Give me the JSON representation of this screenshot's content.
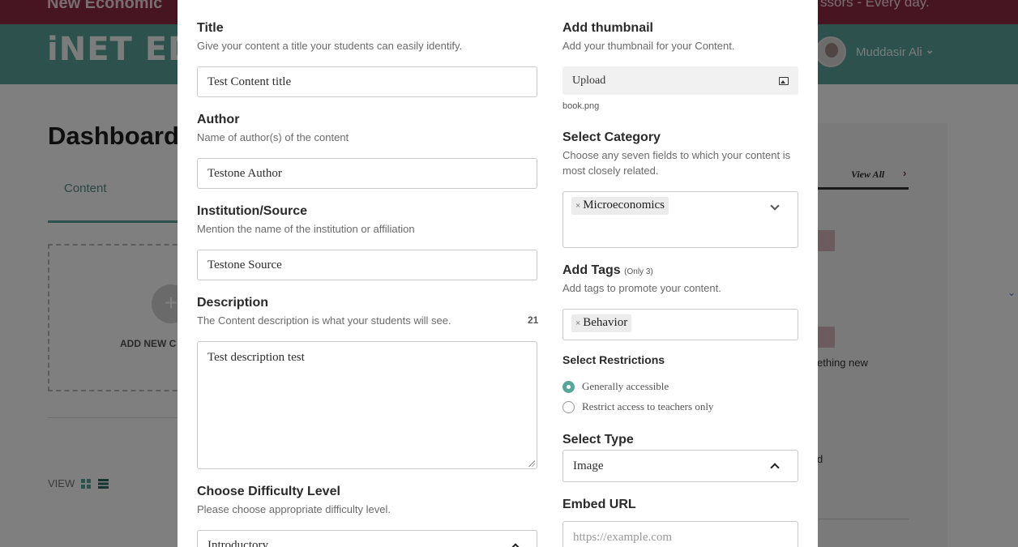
{
  "background": {
    "topbar": {
      "left_text": "New Economic",
      "right_text": "ssors - Every day."
    },
    "navbar": {
      "logo": "iNET ED.",
      "user_name": "Muddasir Ali",
      "user_chevron": "⌄"
    },
    "dashboard": {
      "title": "Dashboard",
      "tab_content": "Content",
      "add_plus": "+",
      "add_new_label": "ADD NEW C",
      "view_label": "VIEW"
    },
    "right_panel": {
      "view_all": "View All",
      "view_all_chevron": "›",
      "something_text": "ething new",
      "d_text": "d"
    },
    "far_chevron": "⌄"
  },
  "modal": {
    "title_section": {
      "label": "Title",
      "hint": "Give your content a title your students can easily identify.",
      "value": "Test Content title"
    },
    "author_section": {
      "label": "Author",
      "hint": "Name of author(s) of the content",
      "value": "Testone Author"
    },
    "institution_section": {
      "label": "Institution/Source",
      "hint": "Mention the name of the institution or affiliation",
      "value": "Testone Source"
    },
    "description_section": {
      "label": "Description",
      "hint": "The Content description is what your students will see.",
      "counter": "21",
      "value": "Test description test"
    },
    "difficulty_section": {
      "label": "Choose Difficulty Level",
      "hint": "Please choose appropriate difficulty level.",
      "value": "Introductory"
    },
    "thumbnail_section": {
      "label": "Add thumbnail",
      "hint": "Add your thumbnail for your Content.",
      "upload_label": "Upload",
      "filename": "book.png"
    },
    "category_section": {
      "label": "Select Category",
      "hint": "Choose any seven fields to which your content is most closely related.",
      "remove_glyph": "×",
      "selected": "Microeconomics"
    },
    "tags_section": {
      "label": "Add Tags",
      "label_note": "(Only 3)",
      "hint": "Add tags to promote your content.",
      "remove_glyph": "×",
      "selected": "Behavior"
    },
    "restrictions_section": {
      "label": "Select Restrictions",
      "options": [
        "Generally accessible",
        "Restrict access to teachers only"
      ],
      "selected_index": 0
    },
    "type_section": {
      "label": "Select Type",
      "value": "Image"
    },
    "embed_section": {
      "label": "Embed URL",
      "placeholder": "https://example.com"
    }
  },
  "colors": {
    "brand_teal": "#5aa59a",
    "brand_maroon": "#8e2a44",
    "overlay": "rgba(0,0,0,0.5)"
  }
}
